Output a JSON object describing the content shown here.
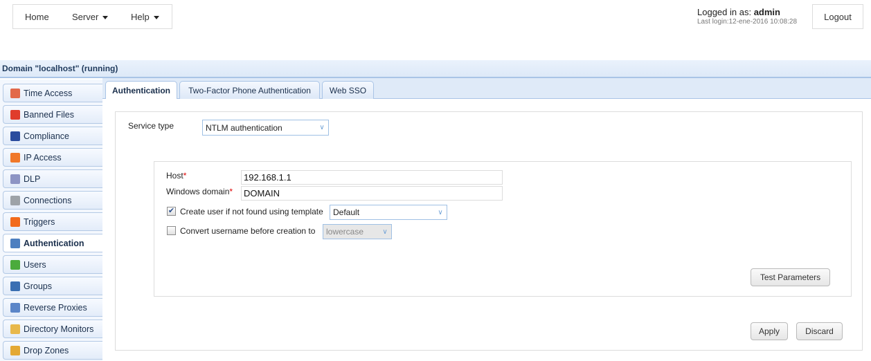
{
  "topnav": {
    "home": "Home",
    "server": "Server",
    "help": "Help"
  },
  "user": {
    "logged_in_prefix": "Logged in as:",
    "username": "admin",
    "last_login": "Last login:12-ene-2016 10:08:28",
    "logout": "Logout"
  },
  "domain": {
    "title": "Domain \"localhost\" (running)"
  },
  "sidebar": {
    "items": [
      {
        "label": "Time Access",
        "icon": "clock-calendar-icon",
        "color": "#e2694a"
      },
      {
        "label": "Banned Files",
        "icon": "banned-file-icon",
        "color": "#e03c2c"
      },
      {
        "label": "Compliance",
        "icon": "officer-icon",
        "color": "#2a4c9e"
      },
      {
        "label": "IP Access",
        "icon": "firewall-icon",
        "color": "#f0782a"
      },
      {
        "label": "DLP",
        "icon": "shield-icon",
        "color": "#8d94c4"
      },
      {
        "label": "Connections",
        "icon": "gears-icon",
        "color": "#9ea3a8"
      },
      {
        "label": "Triggers",
        "icon": "lightning-icon",
        "color": "#f26a1b"
      },
      {
        "label": "Authentication",
        "icon": "id-card-icon",
        "color": "#4d7fc0",
        "active": true
      },
      {
        "label": "Users",
        "icon": "user-icon",
        "color": "#4bab3c"
      },
      {
        "label": "Groups",
        "icon": "group-icon",
        "color": "#3a6fb2"
      },
      {
        "label": "Reverse Proxies",
        "icon": "network-icon",
        "color": "#5b85c8"
      },
      {
        "label": "Directory Monitors",
        "icon": "folder-clock-icon",
        "color": "#e8b84a"
      },
      {
        "label": "Drop Zones",
        "icon": "box-icon",
        "color": "#e4a934"
      }
    ]
  },
  "tabs": [
    {
      "label": "Authentication",
      "active": true
    },
    {
      "label": "Two-Factor Phone Authentication"
    },
    {
      "label": "Web SSO"
    }
  ],
  "form": {
    "service_type_label": "Service type",
    "service_type_value": "NTLM authentication",
    "host_label": "Host",
    "host_value": "192.168.1.1",
    "windows_domain_label": "Windows domain",
    "windows_domain_value": "DOMAIN",
    "required_mark": "*",
    "create_user_label": "Create user if not found using template",
    "create_user_checked": true,
    "template_value": "Default",
    "convert_label": "Convert username before creation to",
    "convert_checked": false,
    "convert_value": "lowercase",
    "test_button": "Test Parameters",
    "apply_button": "Apply",
    "discard_button": "Discard"
  }
}
